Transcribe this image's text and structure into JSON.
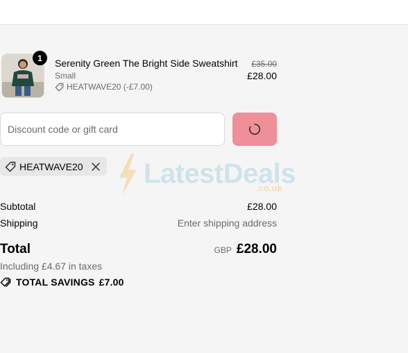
{
  "product": {
    "quantity": "1",
    "name": "Serenity Green The Bright Side Sweatshirt",
    "variant": "Small",
    "discount_line": "HEATWAVE20 (-£7.00)",
    "original_price": "£35.00",
    "price": "£28.00"
  },
  "discount_form": {
    "placeholder": "Discount code or gift card",
    "value": ""
  },
  "applied_code": {
    "code": "HEATWAVE20"
  },
  "summary": {
    "subtotal_label": "Subtotal",
    "subtotal_value": "£28.00",
    "shipping_label": "Shipping",
    "shipping_value": "Enter shipping address",
    "total_label": "Total",
    "currency": "GBP",
    "total_value": "£28.00",
    "taxes_note": "Including £4.67 in taxes",
    "savings_label": "TOTAL SAVINGS",
    "savings_value": "£7.00"
  },
  "watermark": {
    "brand": "LatestDeals",
    "domain": ".co.uk"
  },
  "colors": {
    "apply_button": "#ee8f99",
    "background": "#f5f5f5",
    "muted_text": "#6b6b6b"
  },
  "icons": {
    "discount": "tag-icon",
    "remove": "close-icon",
    "loading": "spinner-icon",
    "savings": "tags-icon"
  }
}
